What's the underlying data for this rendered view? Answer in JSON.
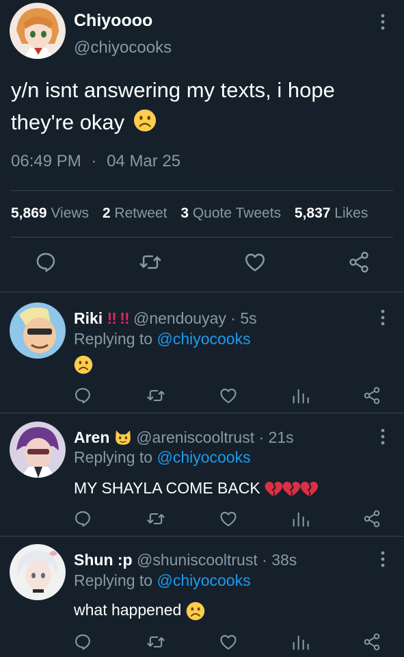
{
  "main_tweet": {
    "name": "Chiyoooo",
    "handle": "@chiyocooks",
    "text": "y/n isnt answering my texts, i hope they're okay",
    "time": "06:49 PM",
    "separator": "·",
    "date": "04 Mar 25",
    "stats": {
      "views_count": "5,869",
      "views_label": "Views",
      "retweets_count": "2",
      "retweets_label": "Retweet",
      "quotes_count": "3",
      "quotes_label": "Quote Tweets",
      "likes_count": "5,837",
      "likes_label": "Likes"
    },
    "actions": [
      "reply-icon",
      "retweet-icon",
      "heart-icon",
      "share-icon"
    ]
  },
  "replies": [
    {
      "name": "Riki",
      "badge": "!! !!",
      "handle": "@nendouyay",
      "time": "· 5s",
      "replying_prefix": "Replying to",
      "replying_to": "@chiyocooks",
      "text": "",
      "emoji": "frowning-face"
    },
    {
      "name": "Aren",
      "badge_icon": "cat-face-icon",
      "handle": "@areniscooltrust",
      "time": "· 21s",
      "replying_prefix": "Replying to",
      "replying_to": "@chiyocooks",
      "text": "MY SHAYLA COME BACK",
      "emoji": "broken-heart x3"
    },
    {
      "name": "Shun :p",
      "handle": "@shuniscooltrust",
      "time": "· 38s",
      "replying_prefix": "Replying to",
      "replying_to": "@chiyocooks",
      "text": "what happened",
      "emoji": "frowning-face"
    }
  ],
  "colors": {
    "background": "#15202b",
    "muted": "#8899a6",
    "link": "#1d9bf0",
    "divider": "#38444d",
    "red": "#e0245e",
    "emoji_yellow": "#ffcc4d"
  }
}
